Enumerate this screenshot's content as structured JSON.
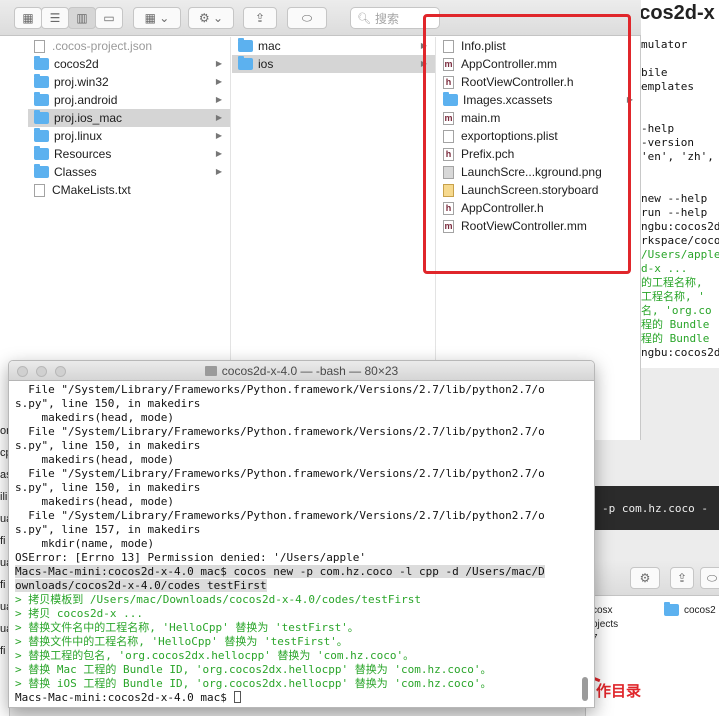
{
  "bg_terminal": {
    "title": "ocos2d-x",
    "lines": [
      {
        "t": "mulator",
        "c": ""
      },
      {
        "t": "",
        "c": ""
      },
      {
        "t": "bile",
        "c": ""
      },
      {
        "t": "emplates",
        "c": ""
      },
      {
        "t": "",
        "c": ""
      },
      {
        "t": "",
        "c": ""
      },
      {
        "t": "-help",
        "c": ""
      },
      {
        "t": "-version",
        "c": ""
      },
      {
        "t": "'en', 'zh',",
        "c": ""
      },
      {
        "t": "",
        "c": ""
      },
      {
        "t": "",
        "c": ""
      },
      {
        "t": "new --help",
        "c": ""
      },
      {
        "t": "run --help",
        "c": ""
      },
      {
        "t": "ngbu:cocos2d",
        "c": ""
      },
      {
        "t": "rkspace/coco",
        "c": ""
      },
      {
        "t": "/Users/apple",
        "c": "g"
      },
      {
        "t": "d-x ...",
        "c": "g"
      },
      {
        "t": "的工程名称,",
        "c": "g"
      },
      {
        "t": "工程名称, '",
        "c": "g"
      },
      {
        "t": "名, 'org.co",
        "c": "g"
      },
      {
        "t": "程的 Bundle",
        "c": "g"
      },
      {
        "t": "程的 Bundle",
        "c": "g"
      },
      {
        "t": "ngbu:cocos2d",
        "c": ""
      }
    ]
  },
  "finder": {
    "search_placeholder": "搜索",
    "col1": [
      {
        "name": ".cocos-project.json",
        "kind": "file",
        "faded": true,
        "arrow": false
      },
      {
        "name": "cocos2d",
        "kind": "folder",
        "arrow": true
      },
      {
        "name": "proj.win32",
        "kind": "folder",
        "arrow": true
      },
      {
        "name": "proj.android",
        "kind": "folder",
        "arrow": true
      },
      {
        "name": "proj.ios_mac",
        "kind": "folder",
        "arrow": true,
        "selected": true
      },
      {
        "name": "proj.linux",
        "kind": "folder",
        "arrow": true
      },
      {
        "name": "Resources",
        "kind": "folder",
        "arrow": true
      },
      {
        "name": "Classes",
        "kind": "folder",
        "arrow": true
      },
      {
        "name": "CMakeLists.txt",
        "kind": "file",
        "arrow": false
      }
    ],
    "col2": [
      {
        "name": "mac",
        "kind": "folder",
        "arrow": true
      },
      {
        "name": "ios",
        "kind": "folder",
        "arrow": true,
        "selected": true
      }
    ],
    "col3": [
      {
        "name": "Info.plist",
        "kind": "file",
        "glyph": ""
      },
      {
        "name": "AppController.mm",
        "kind": "file",
        "glyph": "m"
      },
      {
        "name": "RootViewController.h",
        "kind": "file",
        "glyph": "h"
      },
      {
        "name": "Images.xcassets",
        "kind": "folder",
        "arrow": true
      },
      {
        "name": "main.m",
        "kind": "file",
        "glyph": "m"
      },
      {
        "name": "exportoptions.plist",
        "kind": "file",
        "glyph": ""
      },
      {
        "name": "Prefix.pch",
        "kind": "file",
        "glyph": "h"
      },
      {
        "name": "LaunchScre...kground.png",
        "kind": "img",
        "glyph": ""
      },
      {
        "name": "LaunchScreen.storyboard",
        "kind": "sb",
        "glyph": ""
      },
      {
        "name": "AppController.h",
        "kind": "file",
        "glyph": "h"
      },
      {
        "name": "RootViewController.mm",
        "kind": "file",
        "glyph": "m"
      }
    ],
    "highlight_color": "#e0262b",
    "folder_color": "#5cb1ef"
  },
  "left_strip": {
    "lines": [
      "or",
      "cp",
      "as",
      "ili",
      "ua",
      "fi",
      "ua",
      "fi",
      "ua",
      "ua",
      "fi"
    ]
  },
  "cmd_strip": {
    "text": "-p com.hz.coco -"
  },
  "finder2": {
    "list": [
      "cosx",
      "ojects",
      "7"
    ],
    "col2_item": "cocos2"
  },
  "annotation": "作目录",
  "terminal": {
    "title": "cocos2d-x-4.0 — -bash — 80×23",
    "lines": [
      {
        "t": "  File \"/System/Library/Frameworks/Python.framework/Versions/2.7/lib/python2.7/o",
        "c": ""
      },
      {
        "t": "s.py\", line 150, in makedirs",
        "c": ""
      },
      {
        "t": "    makedirs(head, mode)",
        "c": ""
      },
      {
        "t": "  File \"/System/Library/Frameworks/Python.framework/Versions/2.7/lib/python2.7/o",
        "c": ""
      },
      {
        "t": "s.py\", line 150, in makedirs",
        "c": ""
      },
      {
        "t": "    makedirs(head, mode)",
        "c": ""
      },
      {
        "t": "  File \"/System/Library/Frameworks/Python.framework/Versions/2.7/lib/python2.7/o",
        "c": ""
      },
      {
        "t": "s.py\", line 150, in makedirs",
        "c": ""
      },
      {
        "t": "    makedirs(head, mode)",
        "c": ""
      },
      {
        "t": "  File \"/System/Library/Frameworks/Python.framework/Versions/2.7/lib/python2.7/o",
        "c": ""
      },
      {
        "t": "s.py\", line 157, in makedirs",
        "c": ""
      },
      {
        "t": "    mkdir(name, mode)",
        "c": ""
      },
      {
        "t": "OSError: [Errno 13] Permission denied: '/Users/apple'",
        "c": ""
      },
      {
        "t": "Macs-Mac-mini:cocos2d-x-4.0 mac$ cocos new -p com.hz.coco -l cpp -d /Users/mac/D",
        "c": "hl"
      },
      {
        "t": "ownloads/cocos2d-x-4.0/codes testFirst",
        "c": "hl"
      },
      {
        "t": "> 拷贝模板到 /Users/mac/Downloads/cocos2d-x-4.0/codes/testFirst",
        "c": "g"
      },
      {
        "t": "> 拷贝 cocos2d-x ...",
        "c": "g"
      },
      {
        "t": "> 替换文件名中的工程名称, 'HelloCpp' 替换为 'testFirst'。",
        "c": "g"
      },
      {
        "t": "> 替换文件中的工程名称, 'HelloCpp' 替换为 'testFirst'。",
        "c": "g"
      },
      {
        "t": "> 替换工程的包名, 'org.cocos2dx.hellocpp' 替换为 'com.hz.coco'。",
        "c": "g"
      },
      {
        "t": "> 替换 Mac 工程的 Bundle ID, 'org.cocos2dx.hellocpp' 替换为 'com.hz.coco'。",
        "c": "g"
      },
      {
        "t": "> 替换 iOS 工程的 Bundle ID, 'org.cocos2dx.hellocpp' 替换为 'com.hz.coco'。",
        "c": "g"
      }
    ],
    "prompt": "Macs-Mac-mini:cocos2d-x-4.0 mac$ "
  }
}
